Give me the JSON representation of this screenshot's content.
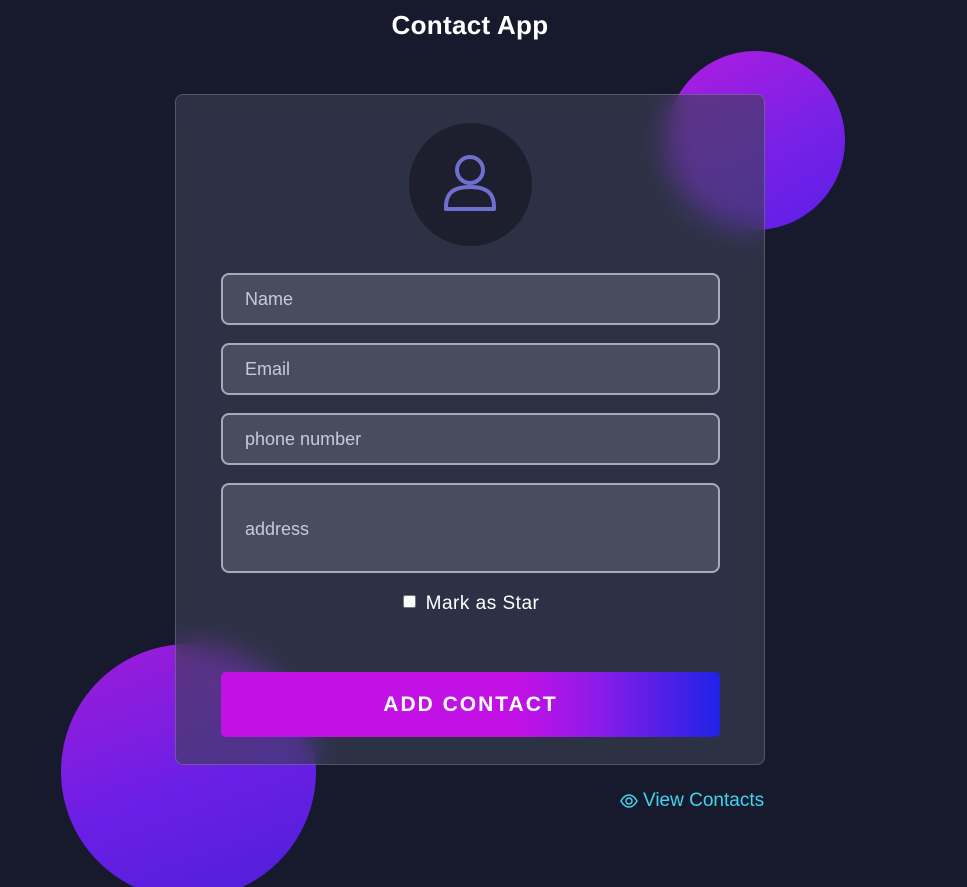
{
  "app": {
    "title": "Contact App"
  },
  "form": {
    "avatar_icon": "user-icon",
    "name_placeholder": "Name",
    "email_placeholder": "Email",
    "phone_placeholder": "phone number",
    "address_placeholder": "address",
    "star_label": "Mark as Star",
    "star_checked": false,
    "submit_label": "ADD CONTACT"
  },
  "footer": {
    "view_icon": "eye-icon",
    "view_label": "View Contacts"
  },
  "colors": {
    "background": "#171a2d",
    "accent_magenta": "#c111e5",
    "accent_blue": "#1f23e6",
    "link": "#3ed5ee",
    "icon": "#6f6fcf"
  }
}
